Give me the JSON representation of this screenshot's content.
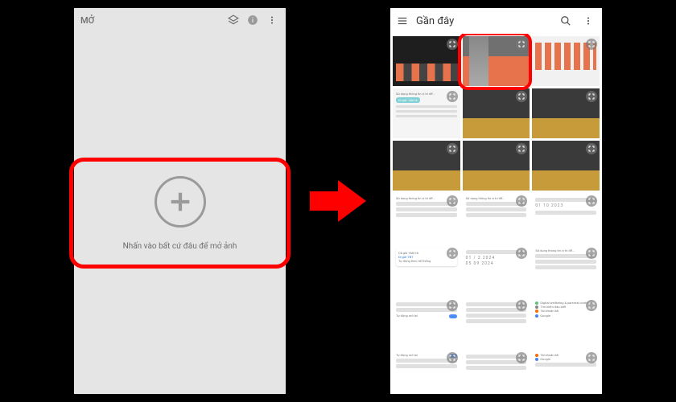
{
  "left_phone": {
    "title": "MỞ",
    "icons": {
      "layers": "layers-icon",
      "info": "info-icon",
      "more": "more-vert-icon"
    },
    "hint": "Nhấn vào bất cứ đâu để mở ảnh"
  },
  "right_phone": {
    "title": "Gần đây",
    "icons": {
      "menu": "hamburger-icon",
      "search": "search-icon",
      "more": "more-vert-icon"
    },
    "thumbs": [
      {
        "kind": "strip"
      },
      {
        "kind": "sunset",
        "highlighted": true
      },
      {
        "kind": "icons"
      },
      {
        "kind": "settings_teal"
      },
      {
        "kind": "city"
      },
      {
        "kind": "city"
      },
      {
        "kind": "city"
      },
      {
        "kind": "city"
      },
      {
        "kind": "city"
      },
      {
        "kind": "settings_usage"
      },
      {
        "kind": "settings_usage"
      },
      {
        "kind": "settings_digits"
      },
      {
        "kind": "settings_dropdown"
      },
      {
        "kind": "settings_digits2"
      },
      {
        "kind": "settings_usage"
      },
      {
        "kind": "settings_toggle"
      },
      {
        "kind": "settings_misc"
      },
      {
        "kind": "settings_apps"
      },
      {
        "kind": "settings_toggle2"
      },
      {
        "kind": "settings_misc2"
      },
      {
        "kind": "settings_apps2"
      }
    ],
    "sample_text": {
      "usage_title": "Sử dụng thông tin vị trí để...",
      "teal_pill": "Đi gửi - Mô tả",
      "digits1": "01   10   2023",
      "digits2": "01 / 2  2024",
      "digits3": "05   09   2024",
      "dd1": "Cả giờ +Mô tả",
      "dd2": "Đi gửi TBT",
      "dd3": "Tự động theo hệ thống",
      "toggle_lbl": "Tự động mở lại",
      "apps1": "Digital wellbeing & parental controls",
      "apps2": "Tìm kiếm đâu biết",
      "apps3": "Tài khoản Mi",
      "apps4": "Google"
    }
  }
}
